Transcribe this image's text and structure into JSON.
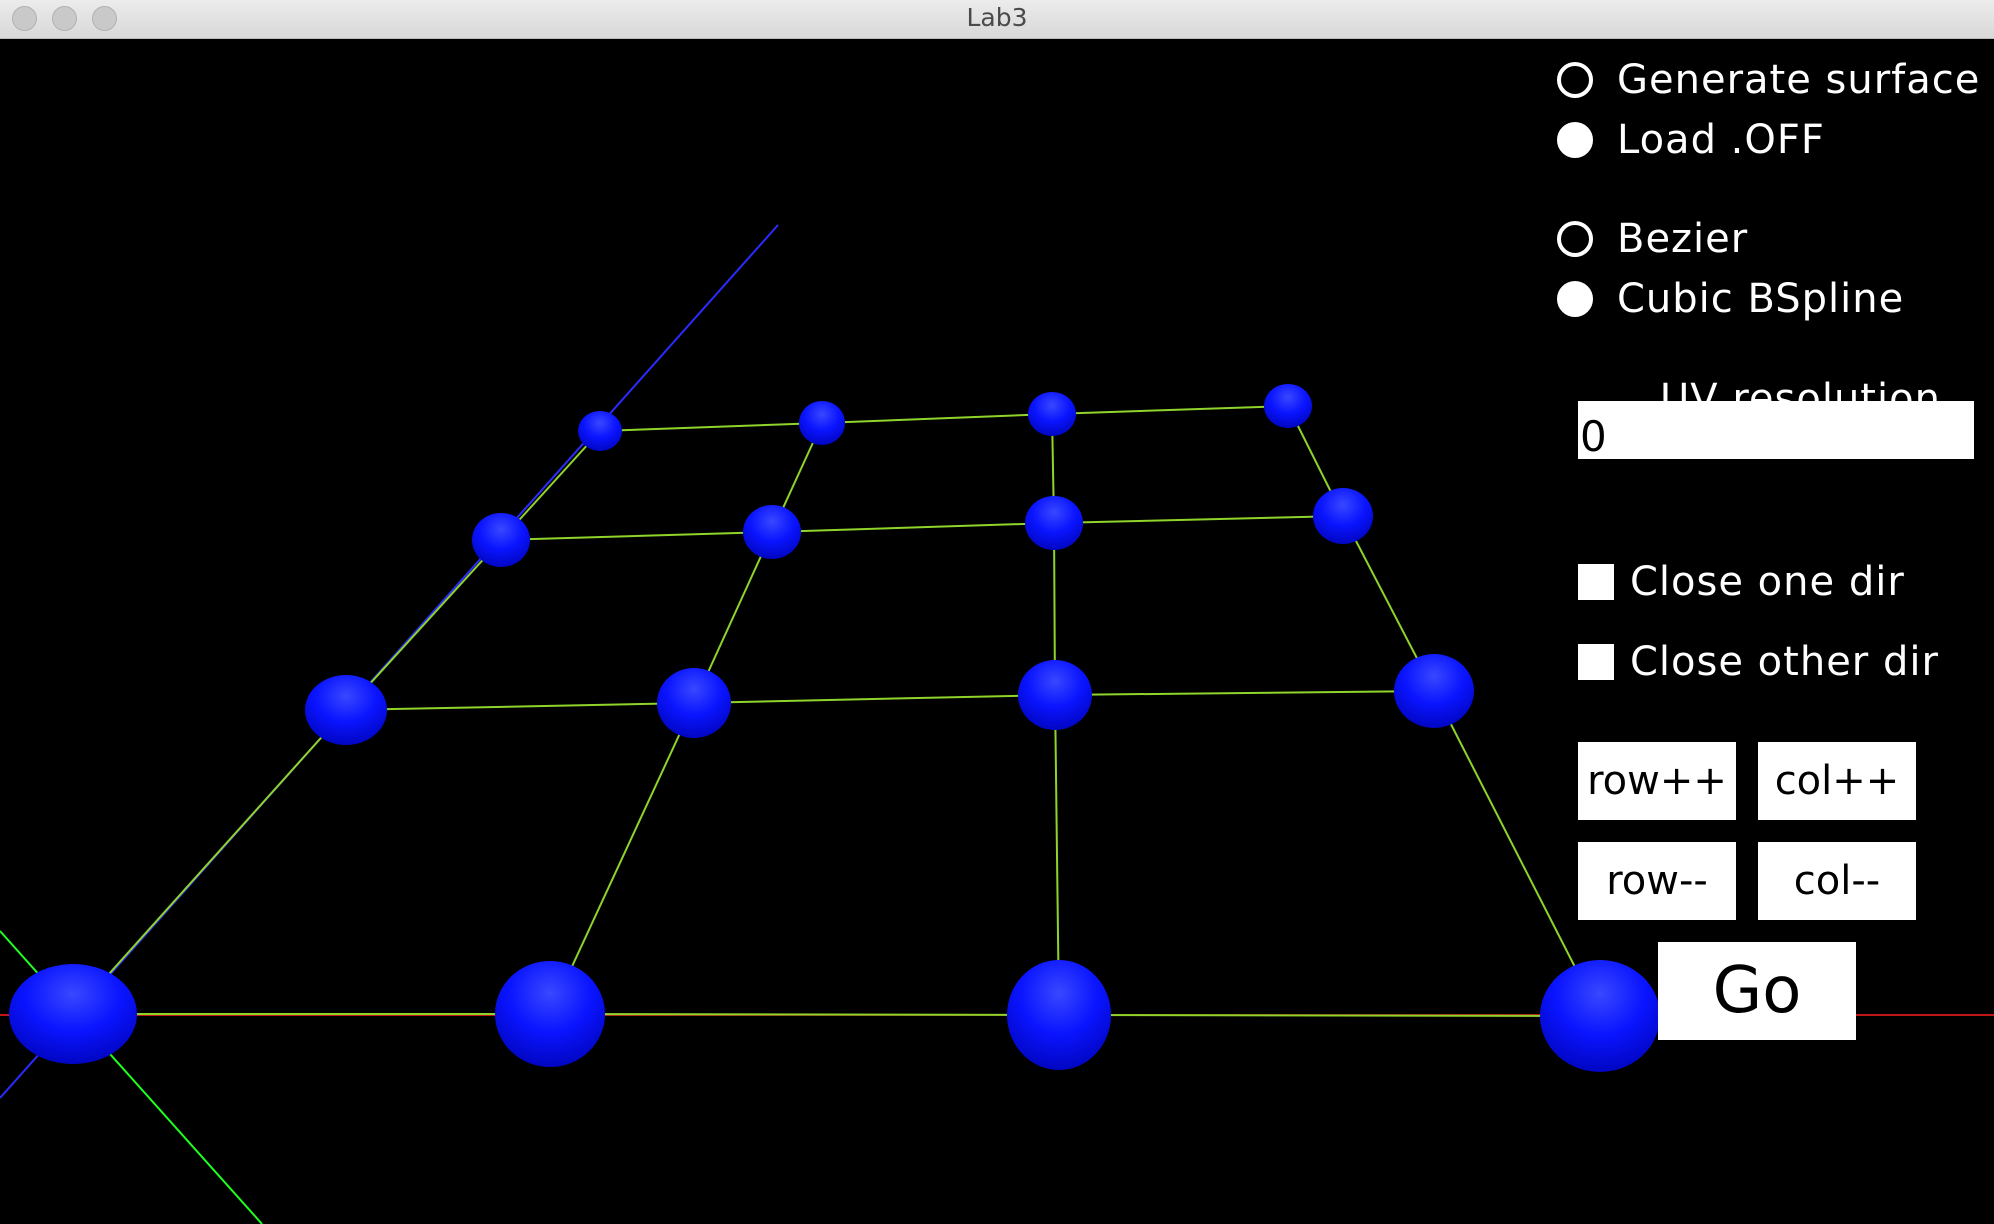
{
  "window": {
    "title": "Lab3"
  },
  "mode_group": [
    {
      "label": "Generate surface",
      "checked": false
    },
    {
      "label": "Load .OFF",
      "checked": true
    }
  ],
  "curve_group": [
    {
      "label": "Bezier",
      "checked": false
    },
    {
      "label": "Cubic BSpline",
      "checked": true
    }
  ],
  "uv": {
    "label": "UV resolution",
    "value": "0"
  },
  "checks": [
    {
      "label": "Close one dir",
      "checked": false
    },
    {
      "label": "Close other dir",
      "checked": false
    }
  ],
  "buttons": {
    "row_inc": "row++",
    "col_inc": "col++",
    "row_dec": "row--",
    "col_dec": "col--",
    "go": "Go"
  },
  "colors": {
    "control_point": "#0a14ff",
    "grid_line": "#8fd42a",
    "axis_x": "#ff1e1e",
    "axis_y": "#1eff1e",
    "axis_z": "#2b2bff"
  }
}
